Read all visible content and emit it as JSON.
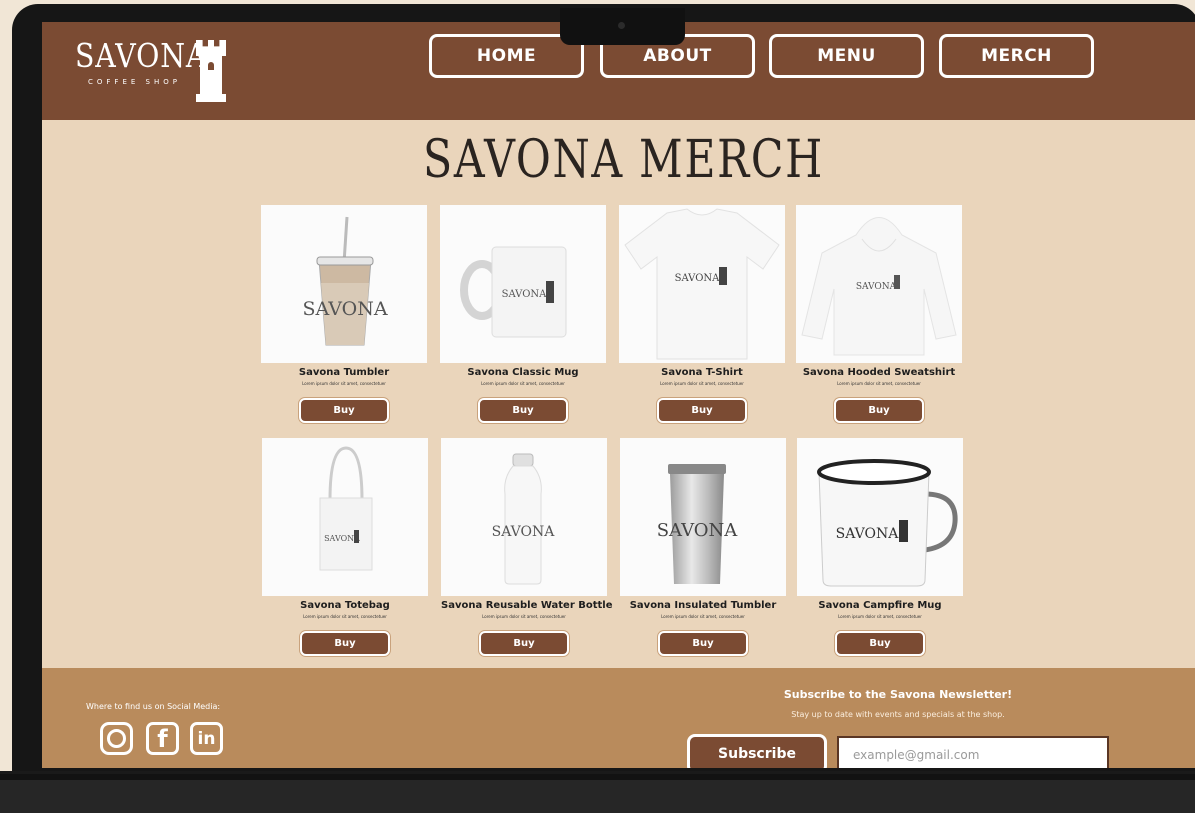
{
  "brand": {
    "name": "SAVONA",
    "tagline": "COFFEE SHOP"
  },
  "nav": {
    "items": [
      {
        "label": "HOME"
      },
      {
        "label": "ABOUT"
      },
      {
        "label": "MENU"
      },
      {
        "label": "MERCH"
      }
    ]
  },
  "page": {
    "title": "SAVONA MERCH"
  },
  "products": [
    {
      "name": "Savona Tumbler",
      "desc": "Lorem ipsum dolor sit amet, consectetuer",
      "buy": "Buy",
      "icon": "tumbler-icon"
    },
    {
      "name": "Savona Classic Mug",
      "desc": "Lorem ipsum dolor sit amet, consectetuer",
      "buy": "Buy",
      "icon": "mug-icon"
    },
    {
      "name": "Savona T-Shirt",
      "desc": "Lorem ipsum dolor sit amet, consectetuer",
      "buy": "Buy",
      "icon": "tshirt-icon"
    },
    {
      "name": "Savona Hooded Sweatshirt",
      "desc": "Lorem ipsum dolor sit amet, consectetuer",
      "buy": "Buy",
      "icon": "hoodie-icon"
    },
    {
      "name": "Savona Totebag",
      "desc": "Lorem ipsum dolor sit amet, consectetuer",
      "buy": "Buy",
      "icon": "totebag-icon"
    },
    {
      "name": "Savona Reusable Water Bottle",
      "desc": "Lorem ipsum dolor sit amet, consectetuer",
      "buy": "Buy",
      "icon": "water-bottle-icon"
    },
    {
      "name": "Savona Insulated Tumbler",
      "desc": "Lorem ipsum dolor sit amet, consectetuer",
      "buy": "Buy",
      "icon": "insulated-tumbler-icon"
    },
    {
      "name": "Savona Campfire Mug",
      "desc": "Lorem ipsum dolor sit amet, consectetuer",
      "buy": "Buy",
      "icon": "campfire-mug-icon"
    }
  ],
  "product_image_label": "SAVONA",
  "footer": {
    "social_label": "Where to find us on Social Media:",
    "social_icons": [
      "instagram-icon",
      "facebook-icon",
      "linkedin-icon"
    ],
    "newsletter_title": "Subscribe to the Savona Newsletter!",
    "newsletter_sub": "Stay up to date with events and specials at the shop.",
    "subscribe_label": "Subscribe",
    "email_placeholder": "example@gmail.com"
  },
  "colors": {
    "brand_brown": "#7b4b33",
    "page_bg": "#ead5bb",
    "footer_bg": "#b98b5c"
  }
}
